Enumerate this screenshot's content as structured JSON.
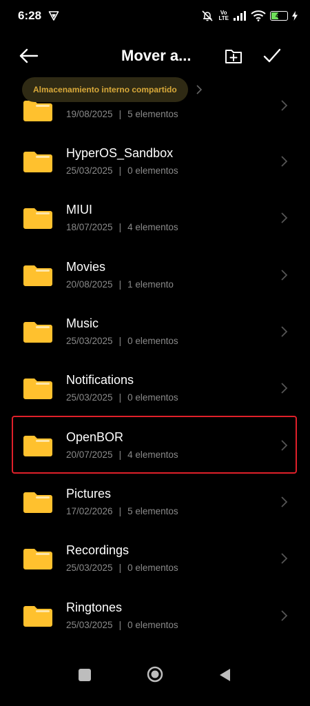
{
  "status_bar": {
    "time": "6:28",
    "volte_top": "Vo",
    "volte_bottom": "LTE",
    "battery_level": "48",
    "battery_fraction": 0.48,
    "battery_color": "#6fe05a"
  },
  "header": {
    "title": "Mover a..."
  },
  "breadcrumb": {
    "label": "Almacenamiento interno compartido"
  },
  "colors": {
    "folder": "#ffc12e",
    "accent": "#d9a93a",
    "highlight": "#e0202a"
  },
  "folders": [
    {
      "name": "",
      "date": "19/08/2025",
      "count": "5 elementos"
    },
    {
      "name": "HyperOS_Sandbox",
      "date": "25/03/2025",
      "count": "0 elementos"
    },
    {
      "name": "MIUI",
      "date": "18/07/2025",
      "count": "4 elementos"
    },
    {
      "name": "Movies",
      "date": "20/08/2025",
      "count": "1 elemento"
    },
    {
      "name": "Music",
      "date": "25/03/2025",
      "count": "0 elementos"
    },
    {
      "name": "Notifications",
      "date": "25/03/2025",
      "count": "0 elementos"
    },
    {
      "name": "OpenBOR",
      "date": "20/07/2025",
      "count": "4 elementos",
      "highlighted": true
    },
    {
      "name": "Pictures",
      "date": "17/02/2026",
      "count": "5 elementos"
    },
    {
      "name": "Recordings",
      "date": "25/03/2025",
      "count": "0 elementos"
    },
    {
      "name": "Ringtones",
      "date": "25/03/2025",
      "count": "0 elementos"
    }
  ],
  "meta_separator": "|"
}
